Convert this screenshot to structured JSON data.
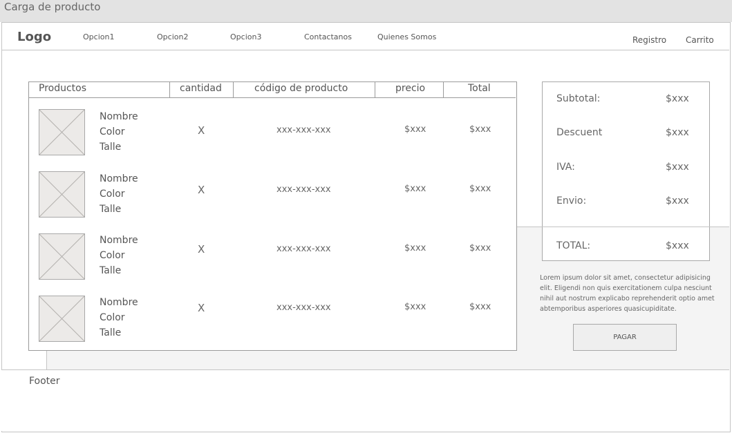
{
  "window": {
    "title": "Carga de producto"
  },
  "nav": {
    "logo": "Logo",
    "links": [
      "Opcion1",
      "Opcion2",
      "Opcion3",
      "Contactanos",
      "Quienes Somos"
    ],
    "registro": "Registro",
    "carrito": "Carrito"
  },
  "table": {
    "headers": [
      "Productos",
      "cantidad",
      "código de producto",
      "precio",
      "Total"
    ],
    "rows": [
      {
        "lines": [
          "Nombre",
          "Color",
          "Talle"
        ],
        "cantidad": "X",
        "codigo": "xxx-xxx-xxx",
        "precio": "$xxx",
        "total": "$xxx"
      },
      {
        "lines": [
          "Nombre",
          "Color",
          "Talle"
        ],
        "cantidad": "X",
        "codigo": "xxx-xxx-xxx",
        "precio": "$xxx",
        "total": "$xxx"
      },
      {
        "lines": [
          "Nombre",
          "Color",
          "Talle"
        ],
        "cantidad": "X",
        "codigo": "xxx-xxx-xxx",
        "precio": "$xxx",
        "total": "$xxx"
      },
      {
        "lines": [
          "Nombre",
          "Color",
          "Talle"
        ],
        "cantidad": "X",
        "codigo": "xxx-xxx-xxx",
        "precio": "$xxx",
        "total": "$xxx"
      }
    ]
  },
  "summary": {
    "items": [
      {
        "label": "Subtotal:",
        "value": "$xxx"
      },
      {
        "label": "Descuent",
        "value": "$xxx"
      },
      {
        "label": "IVA:",
        "value": "$xxx"
      },
      {
        "label": "Envio:",
        "value": "$xxx"
      }
    ],
    "total": {
      "label": "TOTAL:",
      "value": "$xxx"
    }
  },
  "description": "Lorem ipsum dolor sit amet, consectetur adipisicing elit. Eligendi non quis exercitationem culpa nesciunt nihil aut nostrum explicabo reprehenderit optio amet abtemporibus asperiores quasicupiditate.",
  "pay_button": "PAGAR",
  "footer": {
    "label": "Footer"
  },
  "icons": {
    "product_image": "image-placeholder-icon"
  }
}
